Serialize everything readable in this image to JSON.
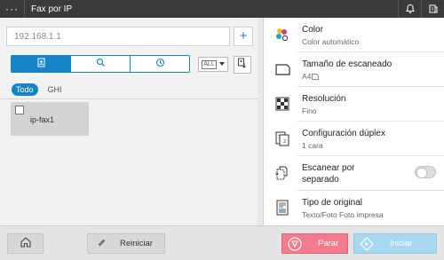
{
  "header": {
    "title": "Fax por IP"
  },
  "address": {
    "value": "192.168.1.1",
    "add_label": "+"
  },
  "search_modes": [
    {
      "name": "address-book",
      "active": true
    },
    {
      "name": "search",
      "active": false
    },
    {
      "name": "history",
      "active": false
    }
  ],
  "index_filter": {
    "value": "ALL"
  },
  "filters": [
    {
      "label": "Todo",
      "active": true
    },
    {
      "label": "GHI",
      "active": false
    }
  ],
  "destinations": [
    {
      "label": "ip-fax1",
      "checked": false
    }
  ],
  "settings": {
    "color": {
      "title": "Color",
      "value": "Color automático"
    },
    "scan_size": {
      "title": "Tamaño de escaneado",
      "value": "A4"
    },
    "resolution": {
      "title": "Resolución",
      "value": "Fino"
    },
    "duplex": {
      "title": "Configuración dúplex",
      "value": "1 cara"
    },
    "separate_scan": {
      "title_line1": "Escanear por",
      "title_line2": "separado",
      "enabled": false
    },
    "original_type": {
      "title": "Tipo de original",
      "value": "Texto/Foto Foto impresa"
    }
  },
  "footer": {
    "reset_label": "Reiniciar",
    "stop_label": "Parar",
    "start_label": "Iniciar"
  },
  "colors": {
    "accent": "#1784c8",
    "stop": "#f47b8b",
    "start": "#a7d8ef",
    "topbar": "#3a3a3a"
  }
}
